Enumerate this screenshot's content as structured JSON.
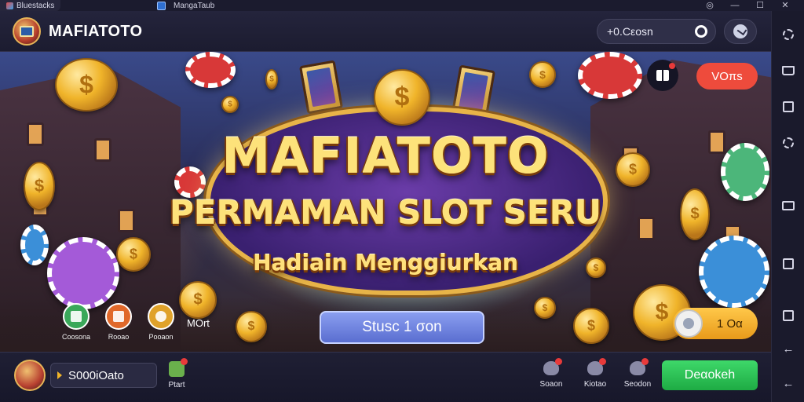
{
  "titlebar": {
    "app_tab_label": "Bluestacks",
    "window_title": "MangaTaub"
  },
  "header": {
    "app_name": "MAFIATOTO",
    "balance_text": "+0.Cεosn"
  },
  "banner": {
    "headline": "MAFIATOTO",
    "subheadline": "PERMAMAN SLOT SERU",
    "tagline": "Hadiain Menggiurkan",
    "cta_label": "Stusc 1 σon",
    "promo_label": "VOπs",
    "counter_text": "1 Oα",
    "quick_actions": [
      {
        "label": "Coosona",
        "icon": "person-chart-icon",
        "color": "#3aa85a"
      },
      {
        "label": "Rooao",
        "icon": "document-icon",
        "color": "#e0682a"
      },
      {
        "label": "Pooaon",
        "icon": "coin-icon",
        "color": "#e0a22a"
      }
    ],
    "more_label": "MOrt"
  },
  "bottombar": {
    "wallet_text": "S000iOato",
    "mini_label": "Ptart",
    "nav": [
      {
        "label": "Soaon",
        "icon": "chat-icon"
      },
      {
        "label": "Kiotao",
        "icon": "gift-icon"
      },
      {
        "label": "Seodon",
        "icon": "settings-icon"
      }
    ],
    "deposit_label": "Deαokeh"
  },
  "colors": {
    "accent_gold": "#f0b42a",
    "promo_red": "#ee4b3c",
    "deposit_green": "#1eab44",
    "cta_blue": "#5a6ed0"
  }
}
